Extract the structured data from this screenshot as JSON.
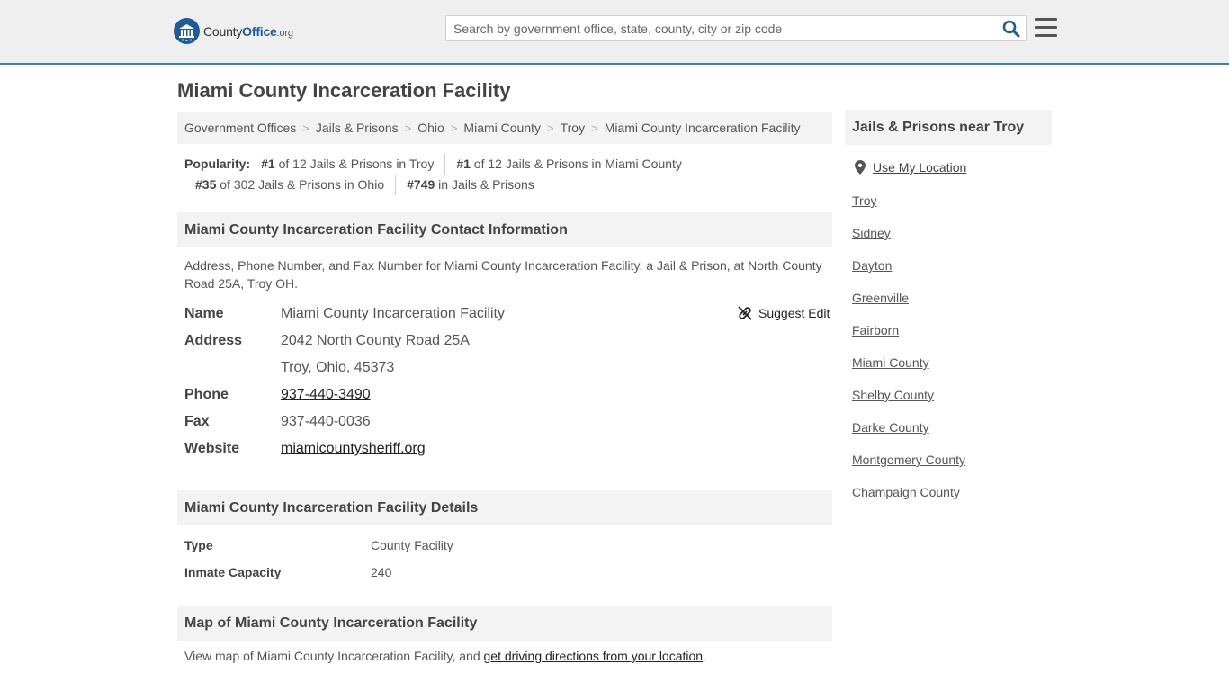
{
  "header": {
    "logo": {
      "main": "County",
      "accent": "Office",
      "suffix": ".org"
    },
    "search": {
      "placeholder": "Search by government office, state, county, city or zip code",
      "value": ""
    },
    "icons": {
      "search": "search-icon",
      "menu": "hamburger-menu-icon",
      "logo": "county-office-seal-icon"
    }
  },
  "page": {
    "title": "Miami County Incarceration Facility"
  },
  "breadcrumb": [
    "Government Offices",
    "Jails & Prisons",
    "Ohio",
    "Miami County",
    "Troy",
    "Miami County Incarceration Facility"
  ],
  "popularity": {
    "label": "Popularity:",
    "items": [
      {
        "rank": "#1",
        "text": " of 12 Jails & Prisons in Troy"
      },
      {
        "rank": "#1",
        "text": " of 12 Jails & Prisons in Miami County"
      },
      {
        "rank": "#35",
        "text": " of 302 Jails & Prisons in Ohio"
      },
      {
        "rank": "#749",
        "text": " in Jails & Prisons"
      }
    ]
  },
  "contact": {
    "heading": "Miami County Incarceration Facility Contact Information",
    "description": "Address, Phone Number, and Fax Number for Miami County Incarceration Facility, a Jail & Prison, at North County Road 25A, Troy OH.",
    "suggest_edit": "Suggest Edit",
    "labels": {
      "name": "Name",
      "address": "Address",
      "phone": "Phone",
      "fax": "Fax",
      "website": "Website"
    },
    "values": {
      "name": "Miami County Incarceration Facility",
      "address_line1": "2042 North County Road 25A",
      "address_line2": "Troy, Ohio, 45373",
      "phone": "937-440-3490",
      "fax": "937-440-0036",
      "website": "miamicountysheriff.org"
    }
  },
  "details": {
    "heading": "Miami County Incarceration Facility Details",
    "rows": [
      {
        "label": "Type",
        "value": "County Facility"
      },
      {
        "label": "Inmate Capacity",
        "value": "240"
      }
    ]
  },
  "map": {
    "heading": "Map of Miami County Incarceration Facility",
    "text_before": "View map of Miami County Incarceration Facility, and ",
    "link": "get driving directions from your location",
    "text_after": "."
  },
  "sidebar": {
    "heading": "Jails & Prisons near Troy",
    "use_location": "Use My Location",
    "links": [
      "Troy",
      "Sidney",
      "Dayton",
      "Greenville",
      "Fairborn",
      "Miami County",
      "Shelby County",
      "Darke County",
      "Montgomery County",
      "Champaign County"
    ]
  },
  "colors": {
    "brand": "#1d5b9a",
    "header_bg": "#efefef",
    "header_border": "#3a7fc1",
    "section_bg": "#f3f3f3"
  }
}
